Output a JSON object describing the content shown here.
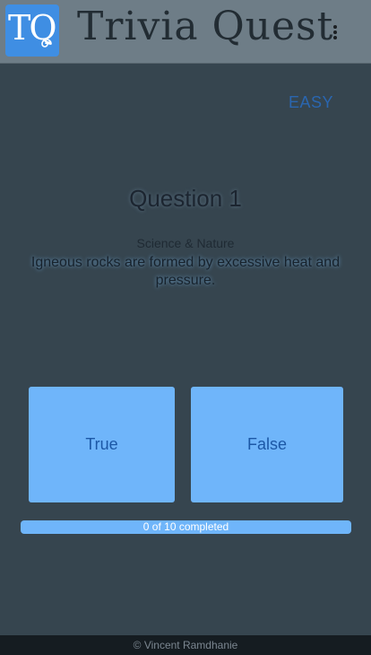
{
  "header": {
    "logo_text": "TQ",
    "title": "Trivia Quest",
    "menu_icon": "more-vertical-icon"
  },
  "quiz": {
    "difficulty": "EASY",
    "question_title": "Question 1",
    "category": "Science & Nature",
    "question_text": "Igneous rocks are formed by excessive heat and pressure.",
    "answers": [
      "True",
      "False"
    ]
  },
  "progress": {
    "completed": 0,
    "total": 10,
    "label": "0 of 10 completed"
  },
  "footer": {
    "text": "© Vincent Ramdhanie"
  },
  "colors": {
    "header_bg": "#6e7d87",
    "page_bg": "#36454f",
    "accent_blue": "#6fb5fa",
    "logo_blue": "#3f8ee3",
    "difficulty": "#2a66b0"
  }
}
